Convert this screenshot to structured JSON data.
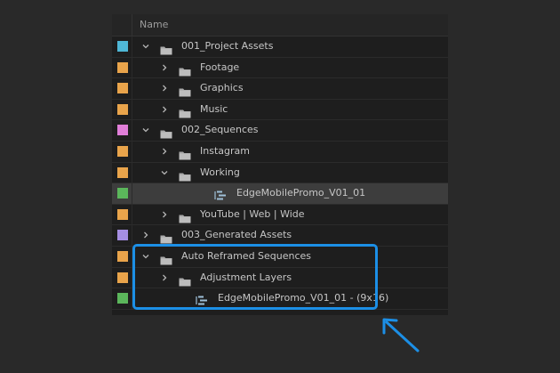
{
  "header": {
    "name_label": "Name"
  },
  "rows": [
    {
      "label": "001_Project Assets",
      "color": "#4fb7d6",
      "indent": 0,
      "chevron": "down",
      "icon": "folder-icon"
    },
    {
      "label": "Footage",
      "color": "#e9a44b",
      "indent": 1,
      "chevron": "right",
      "icon": "folder-icon"
    },
    {
      "label": "Graphics",
      "color": "#e9a44b",
      "indent": 1,
      "chevron": "right",
      "icon": "folder-icon"
    },
    {
      "label": "Music",
      "color": "#e9a44b",
      "indent": 1,
      "chevron": "right",
      "icon": "folder-icon"
    },
    {
      "label": "002_Sequences",
      "color": "#e07ed8",
      "indent": 0,
      "chevron": "down",
      "icon": "folder-icon"
    },
    {
      "label": "Instagram",
      "color": "#e9a44b",
      "indent": 1,
      "chevron": "right",
      "icon": "folder-icon"
    },
    {
      "label": "Working",
      "color": "#e9a44b",
      "indent": 1,
      "chevron": "down",
      "icon": "folder-icon"
    },
    {
      "label": "EdgeMobilePromo_V01_01",
      "color": "#5bb65b",
      "indent": 2,
      "chevron": "none",
      "icon": "sequence-icon",
      "selected": true
    },
    {
      "label": "YouTube | Web | Wide",
      "color": "#e9a44b",
      "indent": 1,
      "chevron": "right",
      "icon": "folder-icon"
    },
    {
      "label": "003_Generated Assets",
      "color": "#a58ee2",
      "indent": 0,
      "chevron": "right",
      "icon": "folder-icon"
    },
    {
      "label": "Auto Reframed Sequences",
      "color": "#e9a44b",
      "indent": 0,
      "chevron": "down",
      "icon": "folder-icon"
    },
    {
      "label": "Adjustment Layers",
      "color": "#e9a44b",
      "indent": 1,
      "chevron": "right",
      "icon": "folder-icon"
    },
    {
      "label": "EdgeMobilePromo_V01_01 - (9x16)",
      "color": "#5bb65b",
      "indent": 1,
      "chevron": "none",
      "icon": "sequence-icon"
    }
  ],
  "colors": {
    "highlight": "#1c8fe6"
  }
}
